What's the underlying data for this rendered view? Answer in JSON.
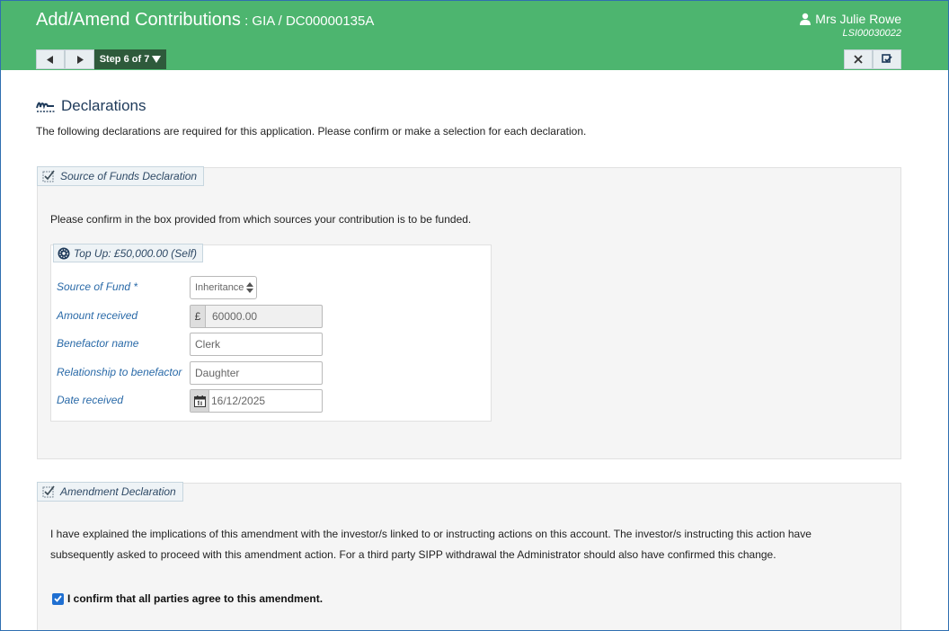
{
  "header": {
    "title_main": "Add/Amend Contributions",
    "title_sub": " : GIA / DC00000135A",
    "user_name": "Mrs Julie Rowe",
    "user_code": "LSI00030022",
    "step_label": "Step 6 of 7"
  },
  "page": {
    "title": "Declarations",
    "intro": "The following declarations are required for this application. Please confirm or make a selection for each declaration."
  },
  "source_of_funds": {
    "legend": "Source of Funds Declaration",
    "text": "Please confirm in the box provided from which sources your contribution is to be funded.",
    "topup": {
      "legend": "Top Up: £50,000.00 (Self)",
      "fields": {
        "source": {
          "label": "Source of Fund *",
          "value": "Inheritance"
        },
        "amount": {
          "label": "Amount received",
          "prefix": "£",
          "value": "60000.00"
        },
        "benefactor": {
          "label": "Benefactor name",
          "value": "Clerk"
        },
        "relationship": {
          "label": "Relationship to benefactor",
          "value": "Daughter"
        },
        "date": {
          "label": "Date received",
          "value": "16/12/2025"
        }
      }
    }
  },
  "amendment": {
    "legend": "Amendment Declaration",
    "text_line1": "I have explained the implications of this amendment with the investor/s linked to or instructing actions on this account. The investor/s instructing this action have",
    "text_line2": "subsequently asked to proceed with this amendment action. For a third party SIPP withdrawal the Administrator should also have confirmed this change.",
    "confirm_label": "I confirm that all parties agree to this amendment.",
    "confirm_checked": true
  },
  "colors": {
    "header_green": "#4db56f",
    "step_dark": "#2e5a3b",
    "label_blue": "#2a6aa8",
    "checkbox_blue": "#1f6fd1"
  }
}
